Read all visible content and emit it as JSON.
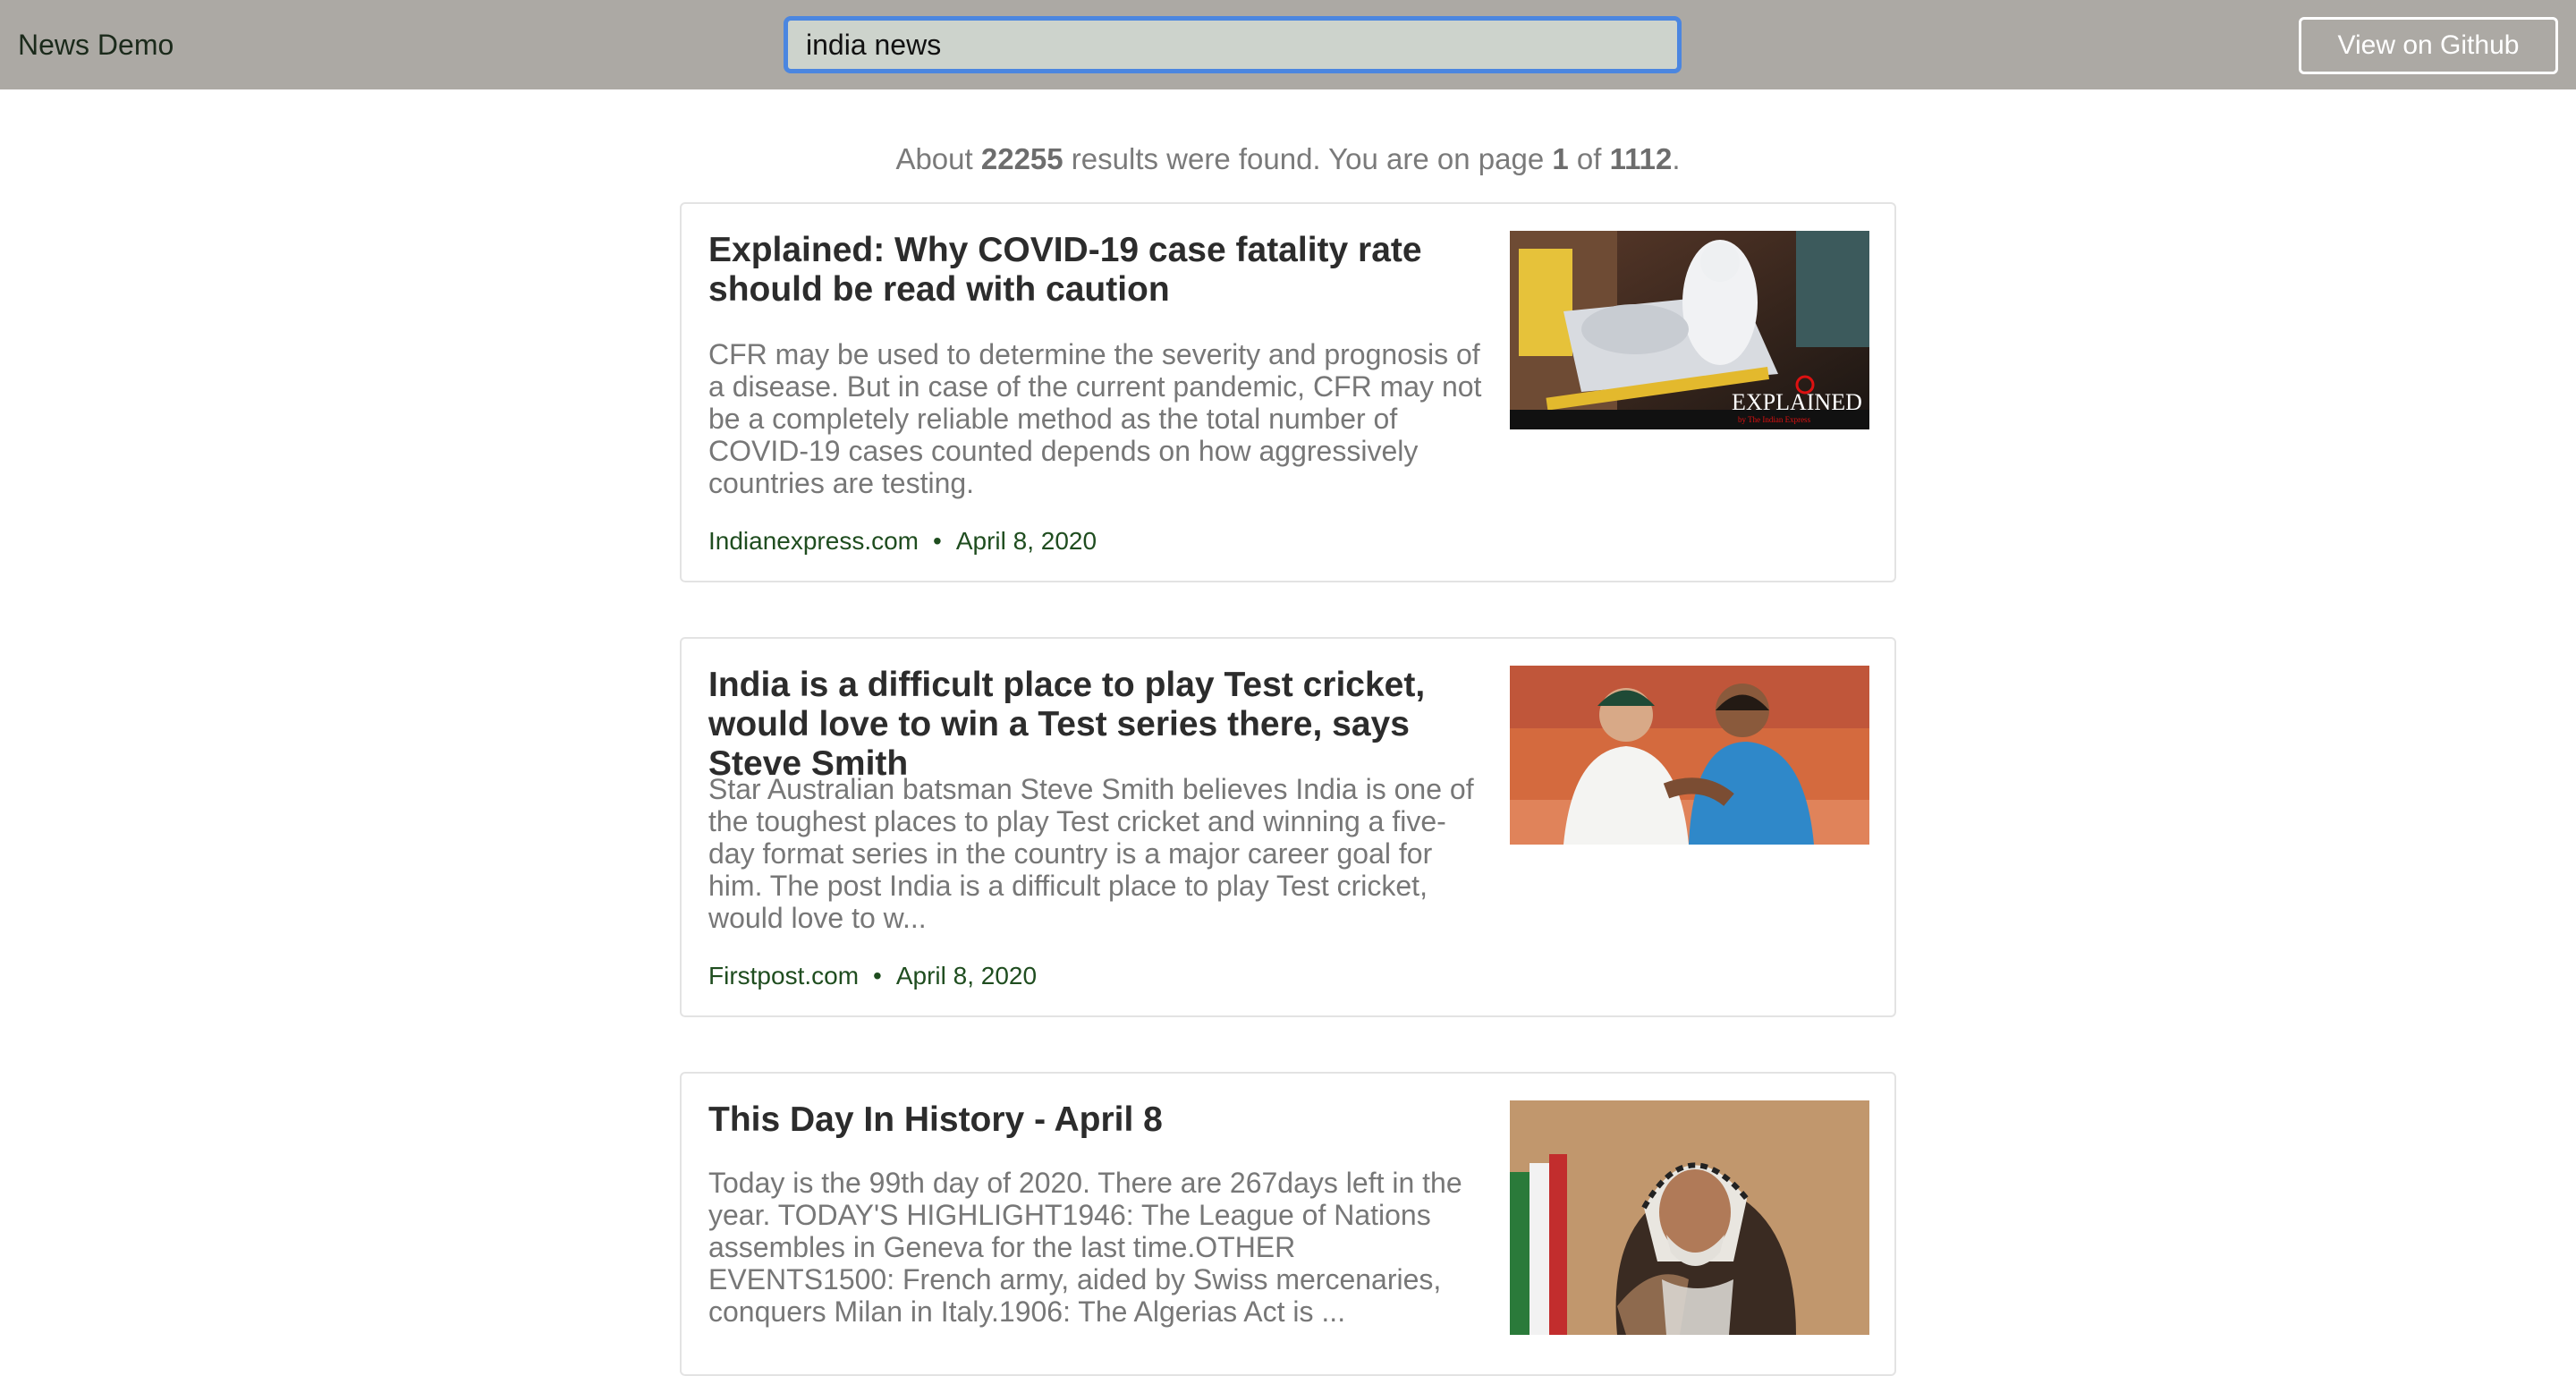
{
  "header": {
    "brand": "News Demo",
    "search_value": "india news",
    "github_label": "View on Github"
  },
  "results_summary": {
    "prefix": "About",
    "count": "22255",
    "middle": "results were found. You are on page",
    "page": "1",
    "of": "of",
    "total_pages": "1112",
    "suffix": "."
  },
  "articles": [
    {
      "title": "Explained: Why COVID-19 case fatality rate should be read with caution",
      "description": "CFR may be used to determine the severity and prognosis of a disease. But in case of the current pandemic, CFR may not be a completely reliable method as the total number of COVID-19 cases counted depends on how aggressively countries are testing.",
      "source": "Indianexpress.com",
      "separator": "•",
      "date": "April 8, 2020",
      "image_overlay": "EXPLAINED",
      "image_overlay_sub": "by The Indian Express"
    },
    {
      "title": "India is a difficult place to play Test cricket, would love to win a Test series there, says Steve Smith",
      "description": "Star Australian batsman Steve Smith believes India is one of the toughest places to play Test cricket and winning a five-day format series in the country is a major career goal for him. The post India is a difficult place to play Test cricket, would love to w...",
      "source": "Firstpost.com",
      "separator": "•",
      "date": "April 8, 2020"
    },
    {
      "title": "This Day In History - April 8",
      "description": "Today is the 99th day of 2020. There are 267days left in the year. TODAY'S HIGHLIGHT1946: The League of Nations assembles in Geneva for the last time.OTHER EVENTS1500: French army, aided by Swiss mercenaries, conquers Milan in Italy.1906: The Algerias Act is ...",
      "source": "",
      "separator": "",
      "date": ""
    }
  ],
  "colors": {
    "topbar": "#aca9a4",
    "search_focus": "#4b86e0",
    "meta_text": "#1f4d1f"
  }
}
